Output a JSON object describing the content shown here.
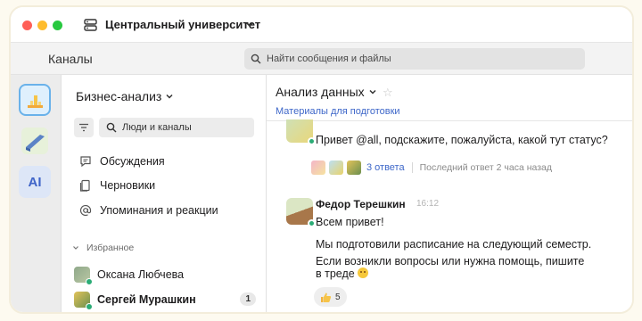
{
  "window": {
    "workspace_name": "Центральный университет"
  },
  "header": {
    "title": "Каналы",
    "search_placeholder": "Найти сообщения и файлы"
  },
  "rail": {
    "apps": [
      {
        "name": "analytics-app",
        "selected": true
      },
      {
        "name": "design-app",
        "selected": false
      },
      {
        "name": "ai-app",
        "label": "AI",
        "selected": false
      }
    ]
  },
  "sidebar": {
    "group_name": "Бизнес-анализ",
    "people_search_placeholder": "Люди и каналы",
    "nav": [
      {
        "label": "Обсуждения",
        "icon": "message-icon"
      },
      {
        "label": "Черновики",
        "icon": "drafts-icon"
      },
      {
        "label": "Упоминания и реакции",
        "icon": "at-icon"
      }
    ],
    "favorites_title": "Избранное",
    "favorites": [
      {
        "name": "Оксана Любчева",
        "unread": null,
        "online": true
      },
      {
        "name": "Сергей Мурашкин",
        "unread": "1",
        "online": true
      }
    ]
  },
  "channel": {
    "name": "Анализ данных",
    "bookmark": "Материалы для подготовки"
  },
  "messages": [
    {
      "text": "Привет @all, подскажите, пожалуйста, какой тут статус?",
      "thread": {
        "replies": "3 ответа",
        "last_reply": "Последний ответ 2 часа назад"
      }
    },
    {
      "sender": "Федор Терешкин",
      "time": "16:12",
      "line1": "Всем привет!",
      "line2": "Мы подготовили расписание на следующий семестр.",
      "line3": "Если возникли вопросы или нужна помощь, пишите",
      "line4": "в треде",
      "reaction_count": "5"
    }
  ],
  "colors": {
    "accent": "#3e67c9",
    "online": "#2bac76",
    "selected_border": "#6ab2ea"
  }
}
